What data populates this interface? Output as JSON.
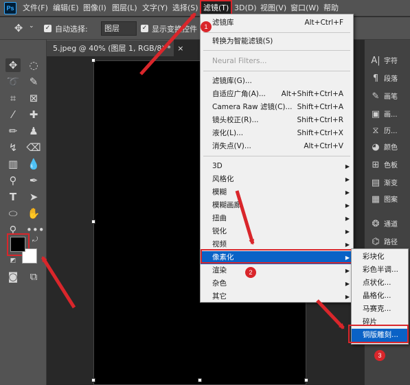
{
  "menubar": {
    "logo": "Ps",
    "items": [
      "文件(F)",
      "编辑(E)",
      "图像(I)",
      "图层(L)",
      "文字(Y)",
      "选择(S)",
      "滤镜(T)",
      "3D(D)",
      "视图(V)",
      "窗口(W)",
      "帮助"
    ]
  },
  "options": {
    "move_icon": "move-tool-icon",
    "auto_select_label": "自动选择:",
    "auto_select_value": "图层",
    "show_transform_label": "显示变换控件"
  },
  "document": {
    "tab_title": "5.jpeg @ 40% (图层 1, RGB/8) *",
    "close_glyph": "×"
  },
  "colors": {
    "foreground": "#000000",
    "background": "#ffffff",
    "menu_highlight": "#0a62c6",
    "annotation_red": "#d9262b"
  },
  "panels": [
    "字符",
    "段落",
    "画笔",
    "画...",
    "历...",
    "颜色",
    "色板",
    "渐变",
    "图案",
    "通道",
    "路径"
  ],
  "filter_menu": {
    "group1": [
      {
        "label": "滤镜库",
        "shortcut": "Alt+Ctrl+F"
      }
    ],
    "group2": [
      {
        "label": "转换为智能滤镜(S)"
      }
    ],
    "group3": [
      {
        "label": "Neural Filters...",
        "disabled": true
      }
    ],
    "group4": [
      {
        "label": "滤镜库(G)..."
      },
      {
        "label": "自适应广角(A)...",
        "shortcut": "Alt+Shift+Ctrl+A"
      },
      {
        "label": "Camera Raw 滤镜(C)...",
        "shortcut": "Shift+Ctrl+A"
      },
      {
        "label": "镜头校正(R)...",
        "shortcut": "Shift+Ctrl+R"
      },
      {
        "label": "液化(L)...",
        "shortcut": "Shift+Ctrl+X"
      },
      {
        "label": "消失点(V)...",
        "shortcut": "Alt+Ctrl+V"
      }
    ],
    "group5": [
      {
        "label": "3D"
      },
      {
        "label": "风格化"
      },
      {
        "label": "模糊"
      },
      {
        "label": "模糊画廊"
      },
      {
        "label": "扭曲"
      },
      {
        "label": "锐化"
      },
      {
        "label": "视频"
      },
      {
        "label": "像素化"
      },
      {
        "label": "渲染"
      },
      {
        "label": "杂色"
      },
      {
        "label": "其它"
      }
    ]
  },
  "pixelate_submenu": [
    "彩块化",
    "彩色半调...",
    "点状化...",
    "晶格化...",
    "马赛克...",
    "碎片",
    "铜版雕刻..."
  ],
  "annotations": [
    "1",
    "2",
    "3"
  ]
}
